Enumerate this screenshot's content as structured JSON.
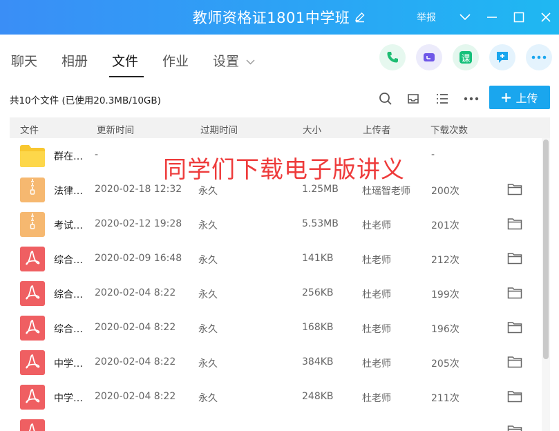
{
  "window": {
    "title": "教师资格证1801中学班",
    "report_label": "举报"
  },
  "tabs": [
    {
      "label": "聊天",
      "active": false
    },
    {
      "label": "相册",
      "active": false
    },
    {
      "label": "文件",
      "active": true
    },
    {
      "label": "作业",
      "active": false
    },
    {
      "label": "设置",
      "active": false
    }
  ],
  "apps": [
    {
      "icon": "phone-icon",
      "color": "#1ebd73",
      "bg": "#e6f8ef"
    },
    {
      "icon": "video-icon",
      "color": "#6e57e8",
      "bg": "#ecebfb"
    },
    {
      "icon": "course-icon",
      "label": "课",
      "color": "#14c07a",
      "bg": "#e4f7ee"
    },
    {
      "icon": "chat-add-icon",
      "color": "#1aa6ee",
      "bg": "#e4f3fd"
    },
    {
      "icon": "more-icon",
      "color": "#1aa6ee",
      "bg": "#e4f3fd"
    }
  ],
  "toolbar": {
    "file_count": "共10个文件 (已使用20.3MB/10GB)",
    "upload_label": "上传"
  },
  "columns": {
    "name": "文件",
    "time": "更新时间",
    "expire": "过期时间",
    "size": "大小",
    "uploader": "上传者",
    "downloads": "下载次数"
  },
  "overlay_text": "同学们下载电子版讲义",
  "files": [
    {
      "type": "folder",
      "name": "群在…",
      "time": "-",
      "expire": "",
      "size": "",
      "uploader": "",
      "downloads": "-"
    },
    {
      "type": "zip",
      "name": "法律…",
      "time": "2020-02-18 12:32",
      "expire": "永久",
      "size": "1.25MB",
      "uploader": "杜瑶智老师",
      "downloads": "200次"
    },
    {
      "type": "zip",
      "name": "考试…",
      "time": "2020-02-12 19:28",
      "expire": "永久",
      "size": "5.53MB",
      "uploader": "杜老师",
      "downloads": "201次"
    },
    {
      "type": "pdf",
      "name": "综合…",
      "time": "2020-02-09 16:48",
      "expire": "永久",
      "size": "141KB",
      "uploader": "杜老师",
      "downloads": "212次"
    },
    {
      "type": "pdf",
      "name": "综合…",
      "time": "2020-02-04 8:22",
      "expire": "永久",
      "size": "256KB",
      "uploader": "杜老师",
      "downloads": "199次"
    },
    {
      "type": "pdf",
      "name": "综合…",
      "time": "2020-02-04 8:22",
      "expire": "永久",
      "size": "168KB",
      "uploader": "杜老师",
      "downloads": "196次"
    },
    {
      "type": "pdf",
      "name": "中学…",
      "time": "2020-02-04 8:22",
      "expire": "永久",
      "size": "384KB",
      "uploader": "杜老师",
      "downloads": "205次"
    },
    {
      "type": "pdf",
      "name": "中学…",
      "time": "2020-02-04 8:22",
      "expire": "永久",
      "size": "248KB",
      "uploader": "杜老师",
      "downloads": "211次"
    },
    {
      "type": "pdf",
      "name": "",
      "time": "",
      "expire": "",
      "size": "",
      "uploader": "",
      "downloads": ""
    }
  ]
}
